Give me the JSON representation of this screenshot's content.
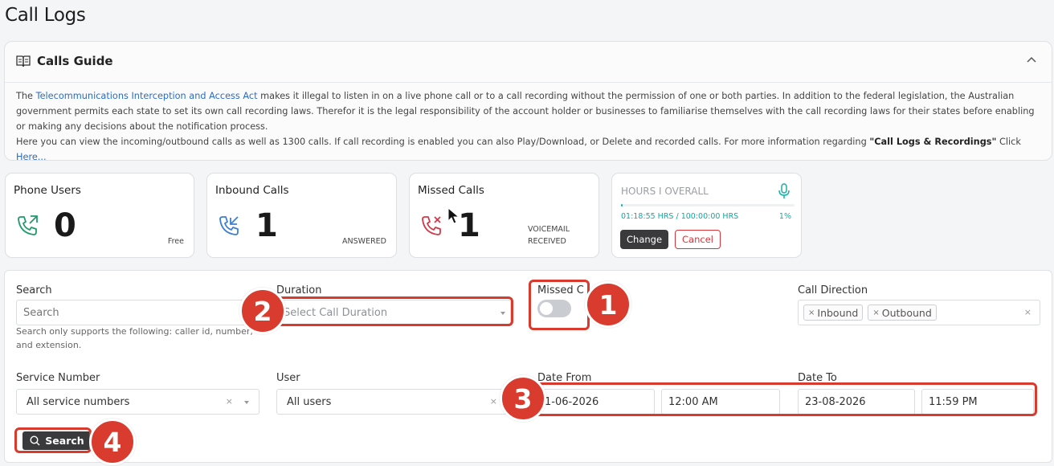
{
  "page_title": "Call Logs",
  "guide": {
    "title": "Calls Guide",
    "p1_prefix": "The ",
    "p1_link": "Telecommunications Interception and Access Act",
    "p1_rest": " makes it illegal to listen in on a live phone call or to a call recording without the permission of one or both parties. In addition to the federal legislation, the Australian government permits each state to set its own call recording laws. Therefor it is the legal responsibility of the account holder or businesses to familiarise themselves with the call recording laws for their states before enabling or making any decisions about the notification process.",
    "p2_prefix": "Here you can view the incoming/outbound calls as well as 1300 calls. If call recording is enabled you can also Play/Download, or Delete and recorded calls. For more information regarding ",
    "p2_bold": "\"Call Logs & Recordings\"",
    "p2_mid": " Click ",
    "p2_link": "Here..."
  },
  "stats": {
    "phone_users": {
      "title": "Phone Users",
      "value": "0",
      "sub": "Free"
    },
    "inbound": {
      "title": "Inbound Calls",
      "value": "1",
      "sub": "ANSWERED"
    },
    "missed": {
      "title": "Missed Calls",
      "value": "1",
      "sub_line1": "VOICEMAIL",
      "sub_line2": "RECEIVED"
    },
    "hours": {
      "title": "HOURS I OVERALL",
      "usage": "01:18:55 HRS / 100:00:00 HRS",
      "percent_label": "1%",
      "percent": 1,
      "change_label": "Change",
      "cancel_label": "Cancel"
    }
  },
  "filters": {
    "search": {
      "label": "Search",
      "placeholder": "Search",
      "help": "Search only supports the following: caller id, number, and extension."
    },
    "duration": {
      "label": "Duration",
      "placeholder": "Select Call Duration"
    },
    "missed": {
      "label": "Missed C",
      "checked": false
    },
    "direction": {
      "label": "Call Direction",
      "tags": [
        "Inbound",
        "Outbound"
      ]
    },
    "service_number": {
      "label": "Service Number",
      "value": "All service numbers"
    },
    "user": {
      "label": "User",
      "value": "All users"
    },
    "date_from": {
      "label": "Date From",
      "date": "1-06-2026",
      "time": "12:00 AM"
    },
    "date_to": {
      "label": "Date To",
      "date": "23-08-2026",
      "time": "11:59 PM"
    },
    "search_button": "Search"
  },
  "annotations": [
    "1",
    "2",
    "3",
    "4"
  ],
  "colors": {
    "accent_red": "#d83a2e",
    "teal": "#12b0a8",
    "dark_button": "#3a3a3c"
  }
}
